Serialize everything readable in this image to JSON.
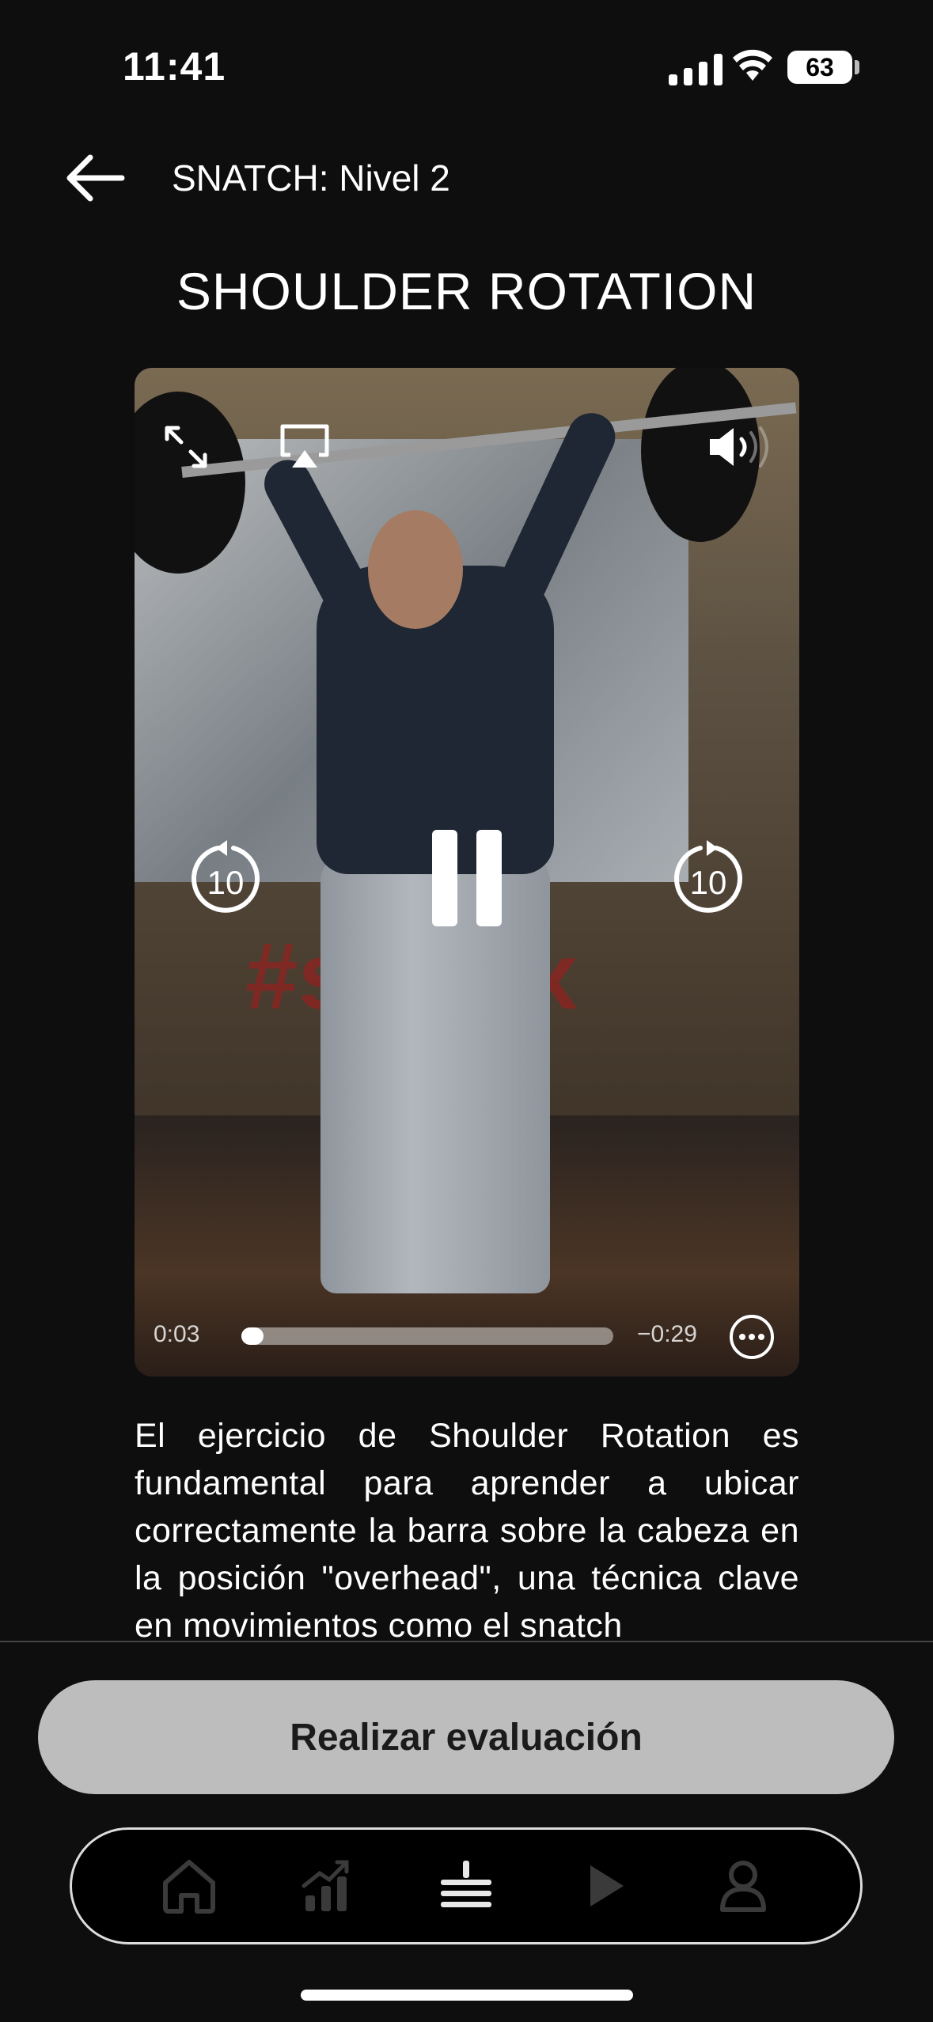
{
  "status_bar": {
    "time": "11:41",
    "battery": "63"
  },
  "header": {
    "title": "SNATCH: Nivel 2"
  },
  "page_title": "SHOULDER ROTATION",
  "video": {
    "elapsed": "0:03",
    "remaining": "−0:29",
    "progress": 0.05,
    "skip_back_seconds": "10",
    "skip_forward_seconds": "10",
    "scene_text": "#s      tbox"
  },
  "description": "El ejercicio de Shoulder Rotation es fundamental para aprender a ubicar correctamente la barra sobre la cabeza en la posición \"overhead\", una técnica clave en movimientos como el snatch",
  "actions": {
    "evaluate_label": "Realizar evaluación"
  },
  "tabbar": {
    "tabs": [
      {
        "icon": "home-icon",
        "active": false
      },
      {
        "icon": "stats-icon",
        "active": false
      },
      {
        "icon": "list-icon",
        "active": true
      },
      {
        "icon": "play-icon",
        "active": false
      },
      {
        "icon": "profile-icon",
        "active": false
      }
    ]
  },
  "colors": {
    "background": "#0e0e0f",
    "button": "#bdbdbd",
    "inactive_icon": "#3a3a3a"
  }
}
